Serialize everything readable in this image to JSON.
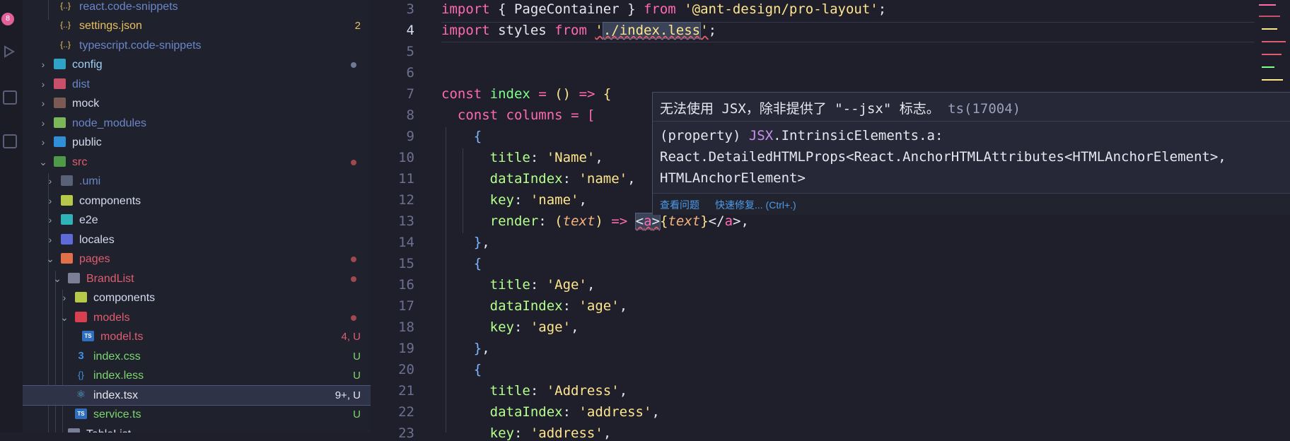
{
  "activity": {
    "badge": "8"
  },
  "explorer": {
    "rows": [
      {
        "label": "react.code-snippets",
        "color": "#6b86c8",
        "status": "",
        "status_color": "",
        "dot": ""
      },
      {
        "label": "settings.json",
        "color": "#e8c060",
        "status": "2",
        "status_color": "#e8c060",
        "dot": ""
      },
      {
        "label": "typescript.code-snippets",
        "color": "#6b86c8",
        "status": "",
        "status_color": "",
        "dot": ""
      },
      {
        "label": "config",
        "color": "#9fd0f5",
        "status": "",
        "status_color": "",
        "dot": "#8a93b0"
      },
      {
        "label": "dist",
        "color": "#6b86c8",
        "status": "",
        "status_color": "",
        "dot": ""
      },
      {
        "label": "mock",
        "color": "#d7daf0",
        "status": "",
        "status_color": "",
        "dot": ""
      },
      {
        "label": "node_modules",
        "color": "#6b86c8",
        "status": "",
        "status_color": "",
        "dot": ""
      },
      {
        "label": "public",
        "color": "#d7daf0",
        "status": "",
        "status_color": "",
        "dot": ""
      },
      {
        "label": "src",
        "color": "#e05d6f",
        "status": "",
        "status_color": "",
        "dot": "#a0474f"
      },
      {
        "label": ".umi",
        "color": "#6b86c8",
        "status": "",
        "status_color": "",
        "dot": ""
      },
      {
        "label": "components",
        "color": "#d7daf0",
        "status": "",
        "status_color": "",
        "dot": ""
      },
      {
        "label": "e2e",
        "color": "#d7daf0",
        "status": "",
        "status_color": "",
        "dot": ""
      },
      {
        "label": "locales",
        "color": "#d7daf0",
        "status": "",
        "status_color": "",
        "dot": ""
      },
      {
        "label": "pages",
        "color": "#e05d6f",
        "status": "",
        "status_color": "",
        "dot": "#a0474f"
      },
      {
        "label": "BrandList",
        "color": "#e05d6f",
        "status": "",
        "status_color": "",
        "dot": "#a0474f"
      },
      {
        "label": "components",
        "color": "#d7daf0",
        "status": "",
        "status_color": "",
        "dot": ""
      },
      {
        "label": "models",
        "color": "#e05d6f",
        "status": "",
        "status_color": "",
        "dot": "#a0474f"
      },
      {
        "label": "model.ts",
        "color": "#e05d6f",
        "status": "4, U",
        "status_color": "#e05d6f",
        "dot": ""
      },
      {
        "label": "index.css",
        "color": "#7dd66f",
        "status": "U",
        "status_color": "#7dd66f",
        "dot": ""
      },
      {
        "label": "index.less",
        "color": "#7dd66f",
        "status": "U",
        "status_color": "#7dd66f",
        "dot": ""
      },
      {
        "label": "index.tsx",
        "color": "#e6e7ef",
        "status": "9+, U",
        "status_color": "#e6e7ef",
        "dot": ""
      },
      {
        "label": "service.ts",
        "color": "#7dd66f",
        "status": "U",
        "status_color": "#7dd66f",
        "dot": ""
      },
      {
        "label": "TableList",
        "color": "#d7daf0",
        "status": "",
        "status_color": "",
        "dot": ""
      }
    ]
  },
  "editor": {
    "line_numbers": [
      "3",
      "4",
      "5",
      "6",
      "7",
      "8",
      "9",
      "10",
      "11",
      "12",
      "13",
      "14",
      "15",
      "16",
      "17",
      "18",
      "19",
      "20",
      "21",
      "22",
      "23"
    ],
    "active_line": "4"
  },
  "hover": {
    "message": "无法使用 JSX，除非提供了 \"--jsx\" 标志。",
    "code": "ts(17004)",
    "signature_line1_a": "(property) ",
    "signature_line1_b": "JSX",
    "signature_line1_c": ".IntrinsicElements.a:",
    "signature_line2": "React.DetailedHTMLProps<React.AnchorHTMLAttributes<HTMLAnchorElement>,",
    "signature_line3": "HTMLAnchorElement>",
    "view_problem": "查看问题",
    "quick_fix": "快速修复... (Ctrl+.)"
  },
  "colors": {
    "accent_pink": "#ff6ab2",
    "string_yellow": "#ffe58c",
    "fn_green": "#7dff8a"
  }
}
